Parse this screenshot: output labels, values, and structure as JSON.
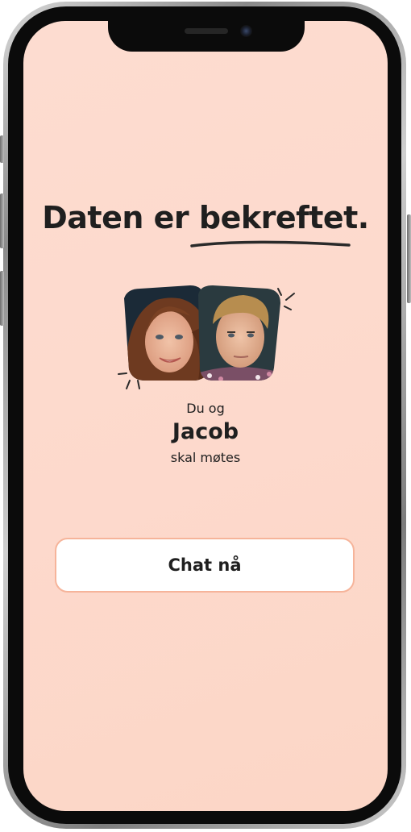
{
  "headline": {
    "prefix": "Daten er",
    "emphasis": "bekreftet."
  },
  "match": {
    "pre_text": "Du og",
    "name": "Jacob",
    "post_text": "skal møtes"
  },
  "actions": {
    "chat_label": "Chat nå"
  },
  "colors": {
    "background": "#fddcd0",
    "button_border": "#f6b49a",
    "text": "#1f1f1f"
  }
}
